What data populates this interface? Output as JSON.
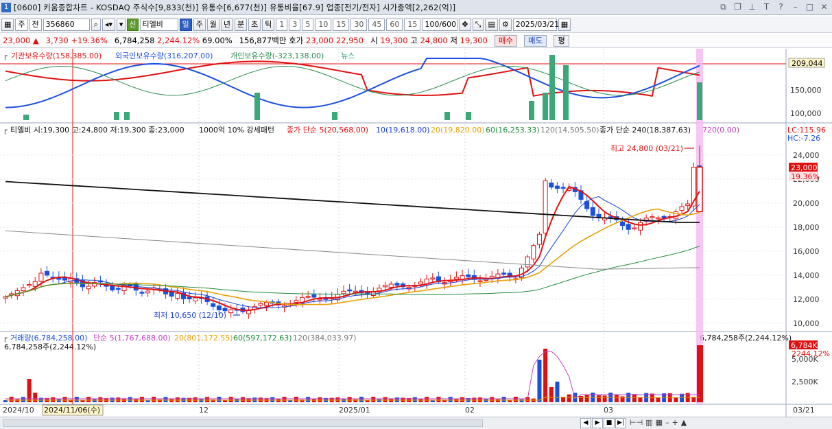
{
  "window": {
    "title": "[0600] 키움종합차트 - KOSDAQ 주식수[9,833(천)] 유통수[6,677(천)] 유통비율[67.9] 업종[전기/전자] 시가총액[2,262(억)]",
    "app_icon": "1"
  },
  "toolbar": {
    "period_mode": "주",
    "market_scope": "전",
    "stock_code": "356860",
    "stock_badge": "신",
    "stock_name": "티엘비",
    "periods": [
      "일",
      "주",
      "월",
      "년",
      "분",
      "초",
      "틱"
    ],
    "active_period": "일",
    "interval_buttons": [
      "1",
      "3",
      "5",
      "10",
      "15",
      "30",
      "45",
      "60"
    ],
    "interval_value": "15",
    "count_display": "100/600",
    "date_value": "2025/03/21"
  },
  "quote": {
    "price": "23,000",
    "arrow": "▲",
    "change": "3,730",
    "change_pct": "+19.36%",
    "volume": "6,784,258",
    "volume_ratio": "2,244.12%",
    "turnover_pct": "69.00%",
    "amount": "156,877백만",
    "hoga_label": "호가",
    "ask": "23,000",
    "bid": "22,950",
    "open_label": "시",
    "open": "19,300",
    "high_label": "고",
    "high": "24,800",
    "low_label": "저",
    "low": "19,300",
    "buy_label": "매수",
    "sell_label": "매도",
    "eval_label": "평"
  },
  "panel_top": {
    "legend": [
      {
        "text": "기관보유수량(158,385.00)",
        "color": "#e01010"
      },
      {
        "text": "외국인보유수량(316,207.00)",
        "color": "#1a4fe0"
      },
      {
        "text": "개인보유수량(-323,138.00)",
        "color": "#2a8a50"
      },
      {
        "text": "뉴스",
        "color": "#22a070"
      }
    ],
    "y_ticks": [
      "150,000",
      "100,000"
    ],
    "last_badge": "209,044"
  },
  "panel_price": {
    "header": "티엘비 시:19,300 고:24,800 저:19,300 종:23,000",
    "header2": "1000억 10% 강세패턴",
    "ma_legend": [
      {
        "text": "종가 단순 5(20,568.00)",
        "color": "#e01010"
      },
      {
        "text": "10(19,618.00)",
        "color": "#1a3fd0"
      },
      {
        "text": "20(19,820.00)",
        "color": "#e8a000"
      },
      {
        "text": "60(16,253.33)",
        "color": "#1e8a3a"
      },
      {
        "text": "120(14,505.50)",
        "color": "#777777"
      },
      {
        "text": "종가 단순 240(18,387.63)",
        "color": "#111111"
      },
      {
        "text": "720(0.00)",
        "color": "#c040c0"
      }
    ],
    "lc_label": "LC:115.96",
    "hc_label": "HC:-7.26",
    "y_ticks": [
      "24,000",
      "22,000",
      "20,000",
      "18,000",
      "16,000",
      "14,000",
      "12,000",
      "10,000"
    ],
    "price_badge": "23,000",
    "pct_badge": "19.36%",
    "high_note": "최고 24,800 (03/21)",
    "low_note": "최저 10,650 (12/10)"
  },
  "panel_volume": {
    "legend": [
      {
        "text": "거래량(6,784,258.00)",
        "color": "#1a4fe0"
      },
      {
        "text": "단순 5(1,767,688.00)",
        "color": "#c040c0"
      },
      {
        "text": "20(801,172.55)",
        "color": "#e8a000"
      },
      {
        "text": "60(597,172.63)",
        "color": "#1e8a3a"
      },
      {
        "text": "120(384,033.97)",
        "color": "#777777"
      }
    ],
    "sub_label": "6,784,258주(2,244.12%)",
    "right_note": "6,784,258주(2,244.12%)",
    "y_ticks": [
      "5,000K",
      "2,500K"
    ],
    "vol_badge": "6,784K",
    "vol_pct_badge": "2244.12%"
  },
  "x_axis": {
    "labels": [
      "2024/10",
      "12",
      "2025/01",
      "02",
      "03"
    ],
    "cursor_date": "2024/11/06(수)",
    "right_date": "03/21"
  },
  "colors": {
    "up": "#e01010",
    "down": "#1a4fe0",
    "highlight": "#f5b8f0"
  }
}
